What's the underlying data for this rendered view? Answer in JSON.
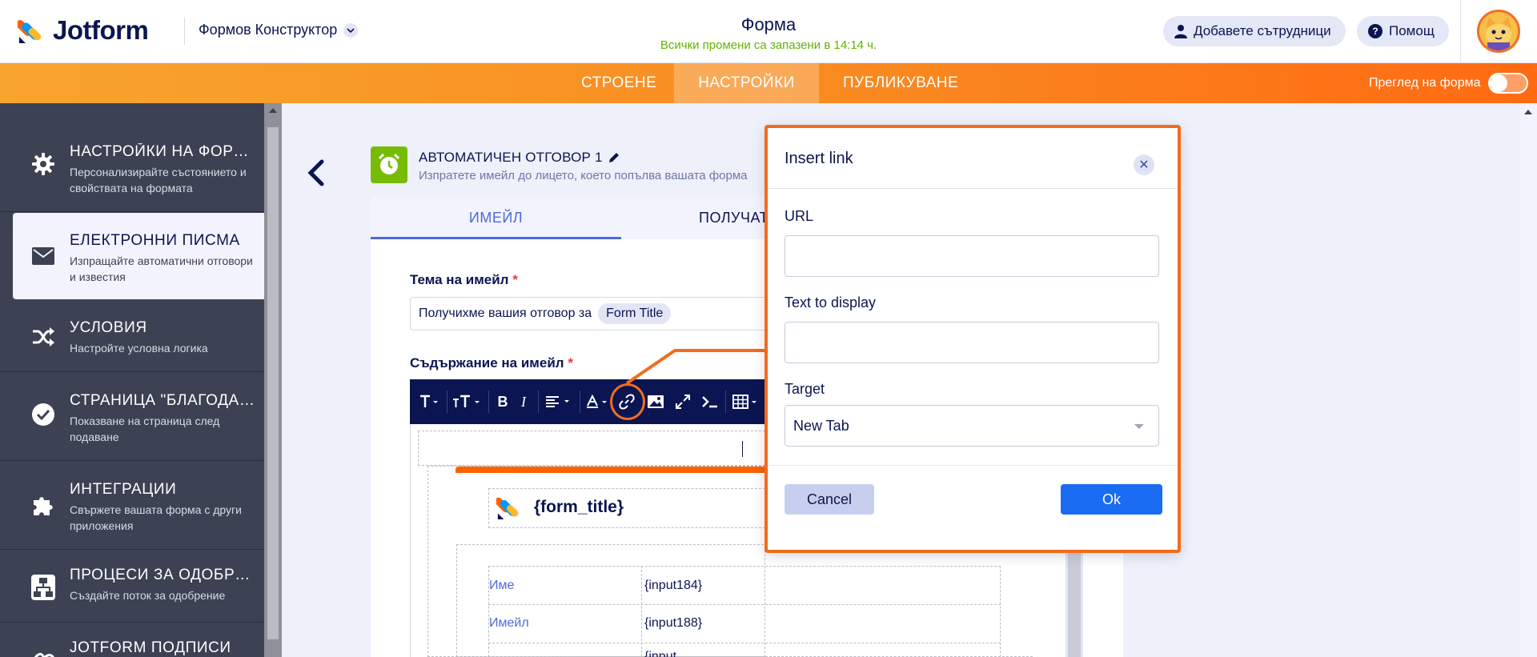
{
  "header": {
    "logo_text": "Jotform",
    "builder_label": "Формов Конструктор",
    "form_title": "Форма",
    "save_status": "Всички промени са запазени в 14:14 ч.",
    "collaborators_label": "Добавете сътрудници",
    "help_label": "Помощ"
  },
  "nav": {
    "tabs": [
      {
        "label": "СТРОЕНЕ"
      },
      {
        "label": "НАСТРОЙКИ"
      },
      {
        "label": "ПУБЛИКУВАНЕ"
      }
    ],
    "active_tab": "НАСТРОЙКИ",
    "preview_label": "Преглед на форма"
  },
  "sidebar": {
    "items": [
      {
        "title": "НАСТРОЙКИ НА ФОРМ...",
        "desc": "Персонализирайте състоянието и свойствата на формата",
        "icon": "gear-icon"
      },
      {
        "title": "ЕЛЕКТРОННИ ПИСМА",
        "desc": "Изпращайте автоматични отговори и известия",
        "icon": "envelope-icon"
      },
      {
        "title": "УСЛОВИЯ",
        "desc": "Настройте условна логика",
        "icon": "shuffle-icon"
      },
      {
        "title": "СТРАНИЦА \"БЛАГОДАРЯ\"",
        "desc": "Показване на страница след подаване",
        "icon": "check-circle-icon"
      },
      {
        "title": "ИНТЕГРАЦИИ",
        "desc": "Свържете вашата форма с други приложения",
        "icon": "puzzle-icon"
      },
      {
        "title": "ПРОЦЕСИ ЗА ОДОБРЕН...",
        "desc": "Създайте поток за одобрение",
        "icon": "flow-icon"
      },
      {
        "title": "JOTFORM ПОДПИСИ",
        "desc": "",
        "icon": "signature-icon"
      }
    ]
  },
  "autoresponder": {
    "title": "АВТОМАТИЧЕН ОТГОВОР 1",
    "subtitle": "Изпратете имейл до лицето, което попълва вашата форма"
  },
  "subtabs": {
    "email": "ИМЕЙЛ",
    "recipients": "ПОЛУЧАТ"
  },
  "email_form": {
    "subject_label": "Тема на имейл",
    "required_mark": "*",
    "subject_text": "Получихме вашия отговор за",
    "subject_tag": "Form Title",
    "content_label": "Съдържание на имейл",
    "form_title_token": "{form_title}",
    "rows": [
      {
        "label": "Име",
        "value": "{input184}"
      },
      {
        "label": "Имейл",
        "value": "{input188}"
      },
      {
        "label": "",
        "value": "{input..."
      }
    ]
  },
  "modal": {
    "title": "Insert link",
    "url_label": "URL",
    "url_value": "",
    "text_label": "Text to display",
    "text_value": "",
    "target_label": "Target",
    "target_value": "New Tab",
    "cancel_label": "Cancel",
    "ok_label": "Ok",
    "close_glyph": "✕"
  },
  "colors": {
    "brand_orange": "#ff6100",
    "nav_gradient_start": "#f8a52d",
    "primary_blue": "#1a6cf2",
    "navy": "#0a1551",
    "sidebar_bg": "#3c4253",
    "saved_green": "#64b200",
    "autoresponder_green": "#78bb07"
  }
}
